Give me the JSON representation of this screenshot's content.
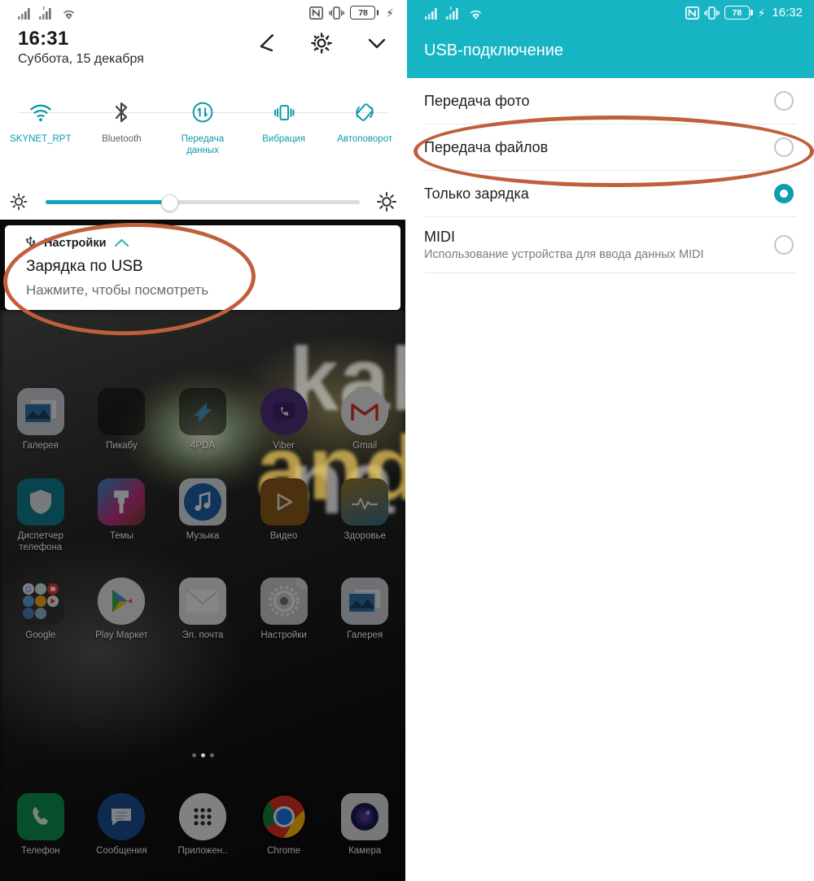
{
  "left_phone": {
    "statusbar": {
      "signal1_icon": "signal-bars-icon",
      "signal2_icon": "signal-bars-icon",
      "wifi_icon": "wifi-icon",
      "nfc_icon": "nfc-icon",
      "vibrate_icon": "vibrate-icon",
      "battery_level": "78",
      "charging_icon": "charging-bolt-icon"
    },
    "header": {
      "time": "16:31",
      "date": "Суббота, 15 декабря",
      "edit_icon": "pencil-edit-icon",
      "settings_icon": "gear-icon",
      "expand_icon": "chevron-down-icon"
    },
    "quick_toggles": [
      {
        "label": "SKYNET_RPT",
        "icon": "wifi-icon",
        "active": true
      },
      {
        "label": "Bluetooth",
        "icon": "bluetooth-icon",
        "active": false
      },
      {
        "label": "Передача данных",
        "icon": "data-transfer-icon",
        "active": true
      },
      {
        "label": "Вибрация",
        "icon": "vibrate-icon",
        "active": true
      },
      {
        "label": "Автоповорот",
        "icon": "auto-rotate-icon",
        "active": true
      }
    ],
    "brightness": {
      "low_icon": "brightness-low-icon",
      "high_icon": "brightness-high-icon",
      "value_percent": "39"
    },
    "notification": {
      "app_icon": "usb-icon",
      "app_name": "Настройки",
      "collapse_icon": "chevron-up-icon",
      "title": "Зарядка по USB",
      "subtitle": "Нажмите, чтобы посмотреть"
    },
    "watermark": {
      "line1": "kak na",
      "line2": "android"
    },
    "home_rows": [
      [
        {
          "label": "Галерея",
          "icon": "gallery-icon"
        },
        {
          "label": "Пикабу",
          "icon": "pikabu-icon"
        },
        {
          "label": "4PDA",
          "icon": "fourpda-icon"
        },
        {
          "label": "Viber",
          "icon": "viber-icon"
        },
        {
          "label": "Gmail",
          "icon": "gmail-icon"
        }
      ],
      [
        {
          "label": "Диспетчер телефона",
          "icon": "shield-icon"
        },
        {
          "label": "Темы",
          "icon": "themes-brush-icon"
        },
        {
          "label": "Музыка",
          "icon": "music-note-icon"
        },
        {
          "label": "Видео",
          "icon": "video-play-icon"
        },
        {
          "label": "Здоровье",
          "icon": "health-heartbeat-icon"
        }
      ],
      [
        {
          "label": "Google",
          "icon": "google-folder-icon"
        },
        {
          "label": "Play Маркет",
          "icon": "play-store-icon"
        },
        {
          "label": "Эл. почта",
          "icon": "email-envelope-icon"
        },
        {
          "label": "Настройки",
          "icon": "gear-icon"
        },
        {
          "label": "Галерея",
          "icon": "gallery-icon"
        }
      ]
    ],
    "dock": [
      {
        "label": "Телефон",
        "icon": "phone-handset-icon"
      },
      {
        "label": "Сообщения",
        "icon": "messages-bubble-icon"
      },
      {
        "label": "Приложен..",
        "icon": "app-drawer-icon"
      },
      {
        "label": "Chrome",
        "icon": "chrome-icon"
      },
      {
        "label": "Камера",
        "icon": "camera-lens-icon"
      }
    ]
  },
  "right_phone": {
    "statusbar": {
      "signal1_icon": "signal-bars-icon",
      "signal2_icon": "signal-bars-icon",
      "wifi_icon": "wifi-icon",
      "nfc_icon": "nfc-icon",
      "vibrate_icon": "vibrate-icon",
      "battery_level": "78",
      "charging_icon": "charging-bolt-icon",
      "time": "16:32"
    },
    "appbar": {
      "title": "USB-подключение"
    },
    "options": [
      {
        "title": "Передача фото",
        "subtitle": "",
        "selected": false
      },
      {
        "title": "Передача файлов",
        "subtitle": "",
        "selected": false
      },
      {
        "title": "Только зарядка",
        "subtitle": "",
        "selected": true
      },
      {
        "title": "MIDI",
        "subtitle": "Использование устройства для ввода данных MIDI",
        "selected": false
      }
    ]
  },
  "annotations": {
    "accent_color": "#c05f3c",
    "items": [
      {
        "name": "ellipse-notification",
        "target": "Зарядка по USB"
      },
      {
        "name": "ellipse-file-transfer",
        "target": "Передача файлов"
      }
    ]
  },
  "colors": {
    "teal_accent": "#0f9aa8",
    "appbar_teal": "#17b5c4",
    "slider_blue": "#12a3c4",
    "annotation_orange": "#c05f3c"
  }
}
